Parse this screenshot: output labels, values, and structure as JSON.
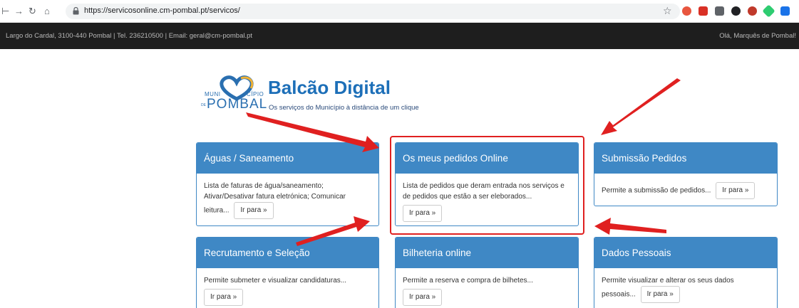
{
  "browser": {
    "url": "https://servicosonline.cm-pombal.pt/servicos/"
  },
  "topbar": {
    "address": "Largo do Cardal, 3100-440 Pombal | Tel. 236210500 | Email: geral@cm-pombal.pt",
    "greeting": "Olá, Marquês de Pombal!"
  },
  "logo": {
    "muni": "MUNI",
    "cipio": "CÍPIO",
    "de": "DE",
    "pombal": "POMBAL",
    "title": "Balcão Digital",
    "subtitle": "Os serviços do Município à distância de um clique"
  },
  "cards": [
    {
      "title": "Águas / Saneamento",
      "desc": "Lista de faturas de água/saneamento; Ativar/Desativar fatura eletrónica; Comunicar leitura...",
      "button": "Ir para »"
    },
    {
      "title": "Os meus pedidos Online",
      "desc": "Lista de pedidos que deram entrada nos serviços e de pedidos que estão a ser eleborados...",
      "button": "Ir para »"
    },
    {
      "title": "Submissão Pedidos",
      "desc": "Permite a submissão de pedidos...",
      "button": "Ir para »"
    },
    {
      "title": "Recrutamento e Seleção",
      "desc": "Permite submeter e visualizar candidaturas...",
      "button": "Ir para »"
    },
    {
      "title": "Bilheteria online",
      "desc": "Permite a reserva e compra de bilhetes...",
      "button": "Ir para »"
    },
    {
      "title": "Dados Pessoais",
      "desc": "Permite visualizar e alterar os seus dados pessoais...",
      "button": "Ir para »"
    }
  ],
  "colors": {
    "card_header": "#3f88c5",
    "annotation_red": "#e02020",
    "topbar_bg": "#1e1e1e"
  }
}
